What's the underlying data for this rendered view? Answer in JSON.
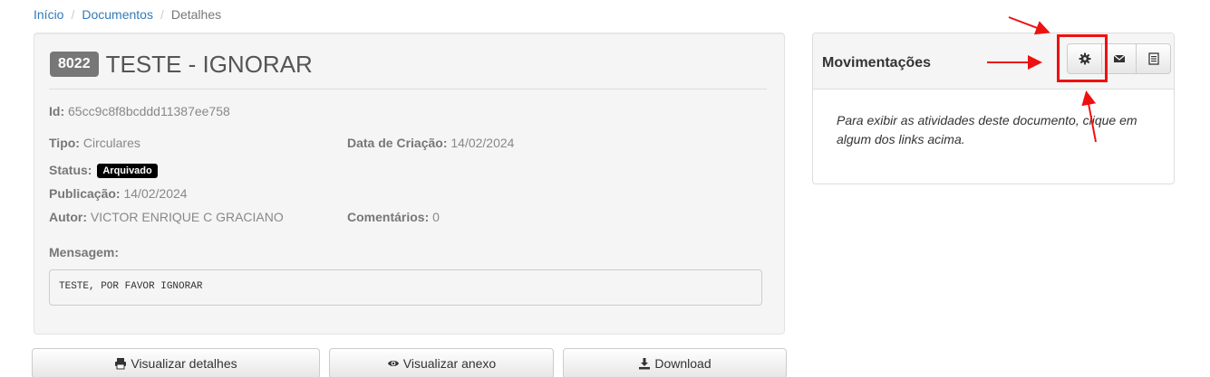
{
  "breadcrumb": {
    "home": "Início",
    "documents": "Documentos",
    "current": "Detalhes"
  },
  "document": {
    "number": "8022",
    "title": "TESTE - IGNORAR",
    "id_label": "Id:",
    "id_value": "65cc9c8f8bcddd11387ee758",
    "type_label": "Tipo:",
    "type_value": "Circulares",
    "created_label": "Data de Criação:",
    "created_value": "14/02/2024",
    "status_label": "Status:",
    "status_value": "Arquivado",
    "published_label": "Publicação:",
    "published_value": "14/02/2024",
    "author_label": "Autor:",
    "author_value": "VICTOR ENRIQUE C GRACIANO",
    "comments_label": "Comentários:",
    "comments_value": "0",
    "message_label": "Mensagem:",
    "message_value": "TESTE, POR FAVOR IGNORAR"
  },
  "actions": {
    "view_details": "Visualizar detalhes",
    "view_attachment": "Visualizar anexo",
    "download": "Download"
  },
  "movements": {
    "title": "Movimentações",
    "hint": "Para exibir as atividades deste documento, clique em algum dos links acima.",
    "buttons": [
      "gear-icon",
      "envelope-icon",
      "list-icon"
    ]
  },
  "colors": {
    "link": "#337ab7",
    "badge_bg": "#777777",
    "status_badge_bg": "#000000",
    "annotation": "#ee1111"
  }
}
